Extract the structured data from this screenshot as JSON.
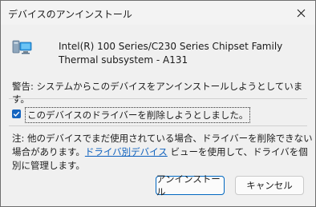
{
  "window": {
    "title": "デバイスのアンインストール"
  },
  "device": {
    "name": "Intel(R) 100 Series/C230 Series Chipset Family Thermal subsystem - A131"
  },
  "warning": "警告: システムからこのデバイスをアンインストールしようとしています。",
  "checkbox": {
    "checked": true,
    "label": "このデバイスのドライバーを削除しようとしました。"
  },
  "note": {
    "text_before": "注: 他のデバイスでまだ使用されている場合、ドライバーを削除できない場合があります。",
    "link": "ドライバ別デバイス",
    "text_after": " ビューを使用して、ドライバを個別に管理します。"
  },
  "buttons": {
    "uninstall": "アンインストール",
    "cancel": "キャンセル"
  },
  "colors": {
    "accent": "#0067c0",
    "link": "#0b5fbd"
  }
}
